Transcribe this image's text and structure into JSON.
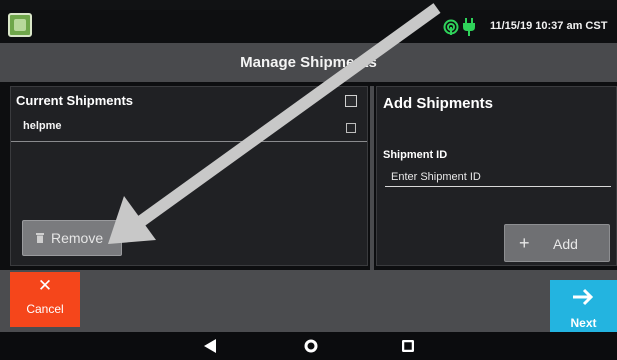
{
  "status_bar": {
    "datetime": "11/15/19 10:37 am CST",
    "icons": [
      "app-icon",
      "wifi-icon",
      "plug-icon"
    ]
  },
  "header": {
    "title": "Manage Shipments"
  },
  "current_shipments": {
    "title": "Current Shipments",
    "items": [
      {
        "label": "helpme",
        "checked": false
      }
    ],
    "remove_label": "Remove"
  },
  "add_shipments": {
    "title": "Add Shipments",
    "field_label": "Shipment ID",
    "field_value": "",
    "field_placeholder": "Enter Shipment ID",
    "add_label": "Add"
  },
  "footer": {
    "cancel_label": "Cancel",
    "next_label": "Next"
  },
  "navigation": {
    "icons": [
      "back-icon",
      "home-icon",
      "recent-apps-icon"
    ]
  },
  "colors": {
    "cancel": "#f5461b",
    "next": "#23b4e0",
    "title_bar": "#494a4d",
    "panel": "#202124",
    "annotation_arrow": "#c8c8c8"
  }
}
